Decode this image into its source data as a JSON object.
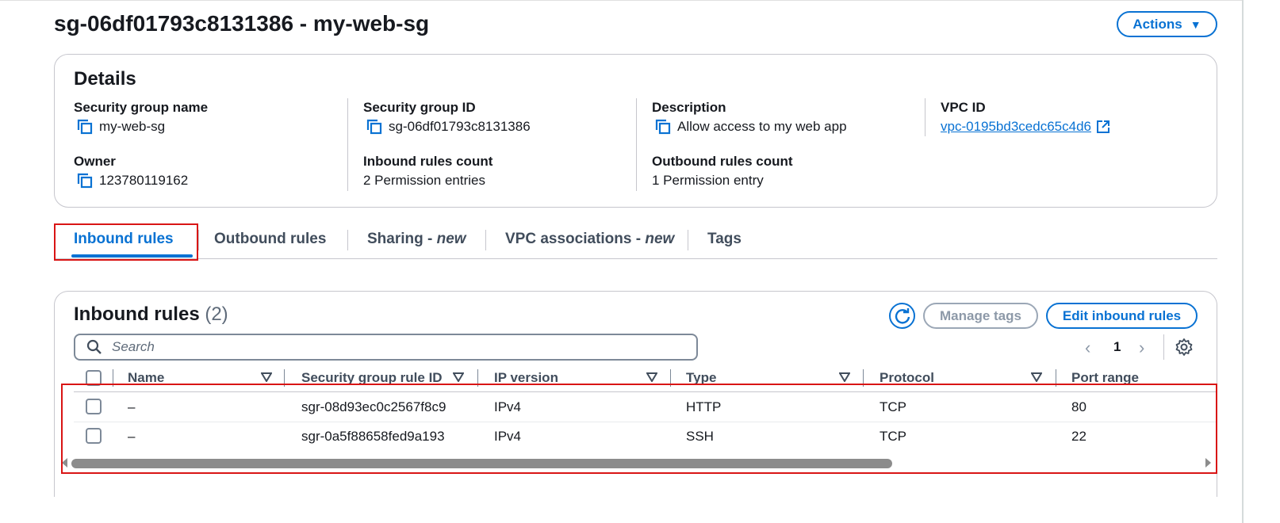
{
  "page": {
    "title": "sg-06df01793c8131386 - my-web-sg",
    "actions_label": "Actions"
  },
  "details": {
    "title": "Details",
    "fields": {
      "sg_name": {
        "label": "Security group name",
        "value": "my-web-sg"
      },
      "sg_id": {
        "label": "Security group ID",
        "value": "sg-06df01793c8131386"
      },
      "description": {
        "label": "Description",
        "value": "Allow access to my web app"
      },
      "vpc_id": {
        "label": "VPC ID",
        "value": "vpc-0195bd3cedc65c4d6"
      },
      "owner": {
        "label": "Owner",
        "value": "123780119162"
      },
      "inbound_count": {
        "label": "Inbound rules count",
        "value": "2 Permission entries"
      },
      "outbound_count": {
        "label": "Outbound rules count",
        "value": "1 Permission entry"
      }
    }
  },
  "tabs": [
    {
      "label": "Inbound rules",
      "active": true
    },
    {
      "label": "Outbound rules",
      "active": false
    },
    {
      "label": "Sharing - ",
      "suffix": "new",
      "active": false
    },
    {
      "label": "VPC associations - ",
      "suffix": "new",
      "active": false
    },
    {
      "label": "Tags",
      "active": false
    }
  ],
  "inbound": {
    "title": "Inbound rules",
    "count": "(2)",
    "manage_tags_label": "Manage tags",
    "edit_label": "Edit inbound rules",
    "search_placeholder": "Search",
    "current_page": "1",
    "columns": [
      "Name",
      "Security group rule ID",
      "IP version",
      "Type",
      "Protocol",
      "Port range"
    ],
    "rows": [
      {
        "name": "–",
        "rule_id": "sgr-08d93ec0c2567f8c9",
        "ip_version": "IPv4",
        "type": "HTTP",
        "protocol": "TCP",
        "port_range": "80"
      },
      {
        "name": "–",
        "rule_id": "sgr-0a5f88658fed9a193",
        "ip_version": "IPv4",
        "type": "SSH",
        "protocol": "TCP",
        "port_range": "22"
      }
    ]
  },
  "colors": {
    "accent": "#0972d3",
    "highlight": "#d91515",
    "text": "#16191f",
    "muted": "#5f6b7a"
  },
  "icons": [
    "copy-icon",
    "external-link-icon",
    "caret-down-icon",
    "refresh-icon",
    "search-icon",
    "chevron-left-icon",
    "chevron-right-icon",
    "settings-gear-icon",
    "sort-icon"
  ]
}
